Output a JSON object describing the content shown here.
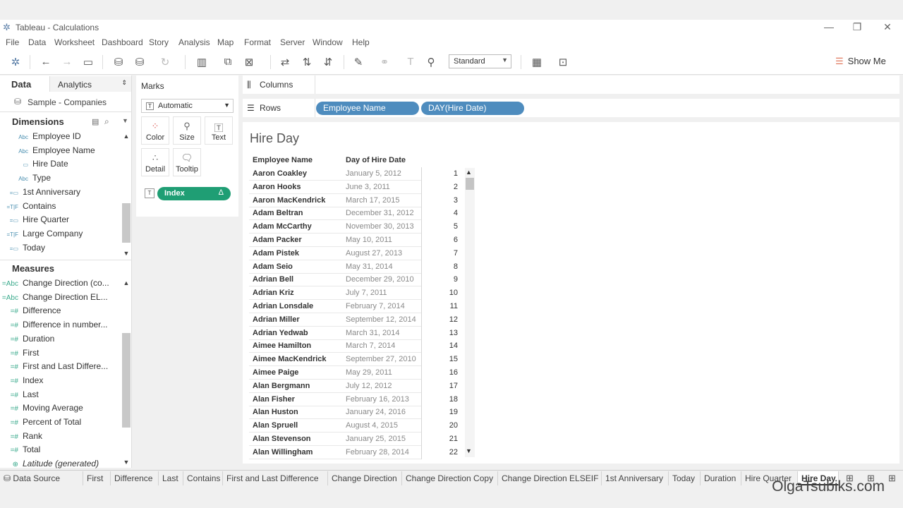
{
  "window": {
    "title": "Tableau - Calculations"
  },
  "menu": [
    "File",
    "Data",
    "Worksheet",
    "Dashboard",
    "Story",
    "Analysis",
    "Map",
    "Format",
    "Server",
    "Window",
    "Help"
  ],
  "toolbar": {
    "fit_select": "Standard",
    "show_me": "Show Me"
  },
  "datapane": {
    "tab_data": "Data",
    "tab_analytics": "Analytics",
    "datasource": "Sample - Companies",
    "dimensions_header": "Dimensions",
    "dimensions": [
      {
        "icon": "Abc",
        "label": "Employee ID"
      },
      {
        "icon": "Abc",
        "label": "Employee Name"
      },
      {
        "icon": "calendar",
        "label": "Hire Date"
      },
      {
        "icon": "Abc",
        "label": "Type"
      },
      {
        "icon": "=calendar",
        "label": "1st Anniversary"
      },
      {
        "icon": "=T|F",
        "label": "Contains"
      },
      {
        "icon": "=calendar",
        "label": "Hire Quarter"
      },
      {
        "icon": "=T|F",
        "label": "Large Company"
      },
      {
        "icon": "=calendar",
        "label": "Today"
      }
    ],
    "measures_header": "Measures",
    "measures": [
      {
        "icon": "=Abc",
        "label": "Change Direction (co..."
      },
      {
        "icon": "=Abc",
        "label": "Change Direction EL..."
      },
      {
        "icon": "=#",
        "label": "Difference"
      },
      {
        "icon": "=#",
        "label": "Difference in number..."
      },
      {
        "icon": "=#",
        "label": "Duration"
      },
      {
        "icon": "=#",
        "label": "First"
      },
      {
        "icon": "=#",
        "label": "First and Last Differe..."
      },
      {
        "icon": "=#",
        "label": "Index"
      },
      {
        "icon": "=#",
        "label": "Last"
      },
      {
        "icon": "=#",
        "label": "Moving Average"
      },
      {
        "icon": "=#",
        "label": "Percent of Total"
      },
      {
        "icon": "=#",
        "label": "Rank"
      },
      {
        "icon": "=#",
        "label": "Total"
      },
      {
        "icon": "globe",
        "label": "Latitude (generated)"
      }
    ]
  },
  "marks": {
    "title": "Marks",
    "type": "Automatic",
    "buttons": [
      "Color",
      "Size",
      "Text",
      "Detail",
      "Tooltip"
    ],
    "pill": "Index",
    "pill_suffix": "Δ"
  },
  "shelves": {
    "columns_label": "Columns",
    "rows_label": "Rows",
    "rows_pills": [
      "Employee Name",
      "DAY(Hire Date)"
    ]
  },
  "view": {
    "title": "Hire Day",
    "headers": [
      "Employee Name",
      "Day of Hire Date"
    ],
    "rows": [
      [
        "Aaron Coakley",
        "January 5, 2012",
        "1"
      ],
      [
        "Aaron Hooks",
        "June 3, 2011",
        "2"
      ],
      [
        "Aaron MacKendrick",
        "March 17, 2015",
        "3"
      ],
      [
        "Adam Beltran",
        "December 31, 2012",
        "4"
      ],
      [
        "Adam McCarthy",
        "November 30, 2013",
        "5"
      ],
      [
        "Adam Packer",
        "May 10, 2011",
        "6"
      ],
      [
        "Adam Pistek",
        "August 27, 2013",
        "7"
      ],
      [
        "Adam Seio",
        "May 31, 2014",
        "8"
      ],
      [
        "Adrian Bell",
        "December 29, 2010",
        "9"
      ],
      [
        "Adrian Kriz",
        "July 7, 2011",
        "10"
      ],
      [
        "Adrian Lonsdale",
        "February 7, 2014",
        "11"
      ],
      [
        "Adrian Miller",
        "September 12, 2014",
        "12"
      ],
      [
        "Adrian Yedwab",
        "March 31, 2014",
        "13"
      ],
      [
        "Aimee Hamilton",
        "March 7, 2014",
        "14"
      ],
      [
        "Aimee MacKendrick",
        "September 27, 2010",
        "15"
      ],
      [
        "Aimee Paige",
        "May 29, 2011",
        "16"
      ],
      [
        "Alan Bergmann",
        "July 12, 2012",
        "17"
      ],
      [
        "Alan Fisher",
        "February 16, 2013",
        "18"
      ],
      [
        "Alan Huston",
        "January 24, 2016",
        "19"
      ],
      [
        "Alan Spruell",
        "August 4, 2015",
        "20"
      ],
      [
        "Alan Stevenson",
        "January 25, 2015",
        "21"
      ],
      [
        "Alan Willingham",
        "February 28, 2014",
        "22"
      ]
    ]
  },
  "sheet_tabs": [
    "Data Source",
    "First",
    "Difference",
    "Last",
    "Contains",
    "First and Last Difference",
    "Change Direction",
    "Change Direction Copy",
    "Change Direction ELSEIF",
    "1st Anniversary",
    "Today",
    "Duration",
    "Hire Quarter",
    "Hire Day"
  ],
  "active_tab": "Hire Day",
  "watermark": "OlgaTsubiks.com"
}
